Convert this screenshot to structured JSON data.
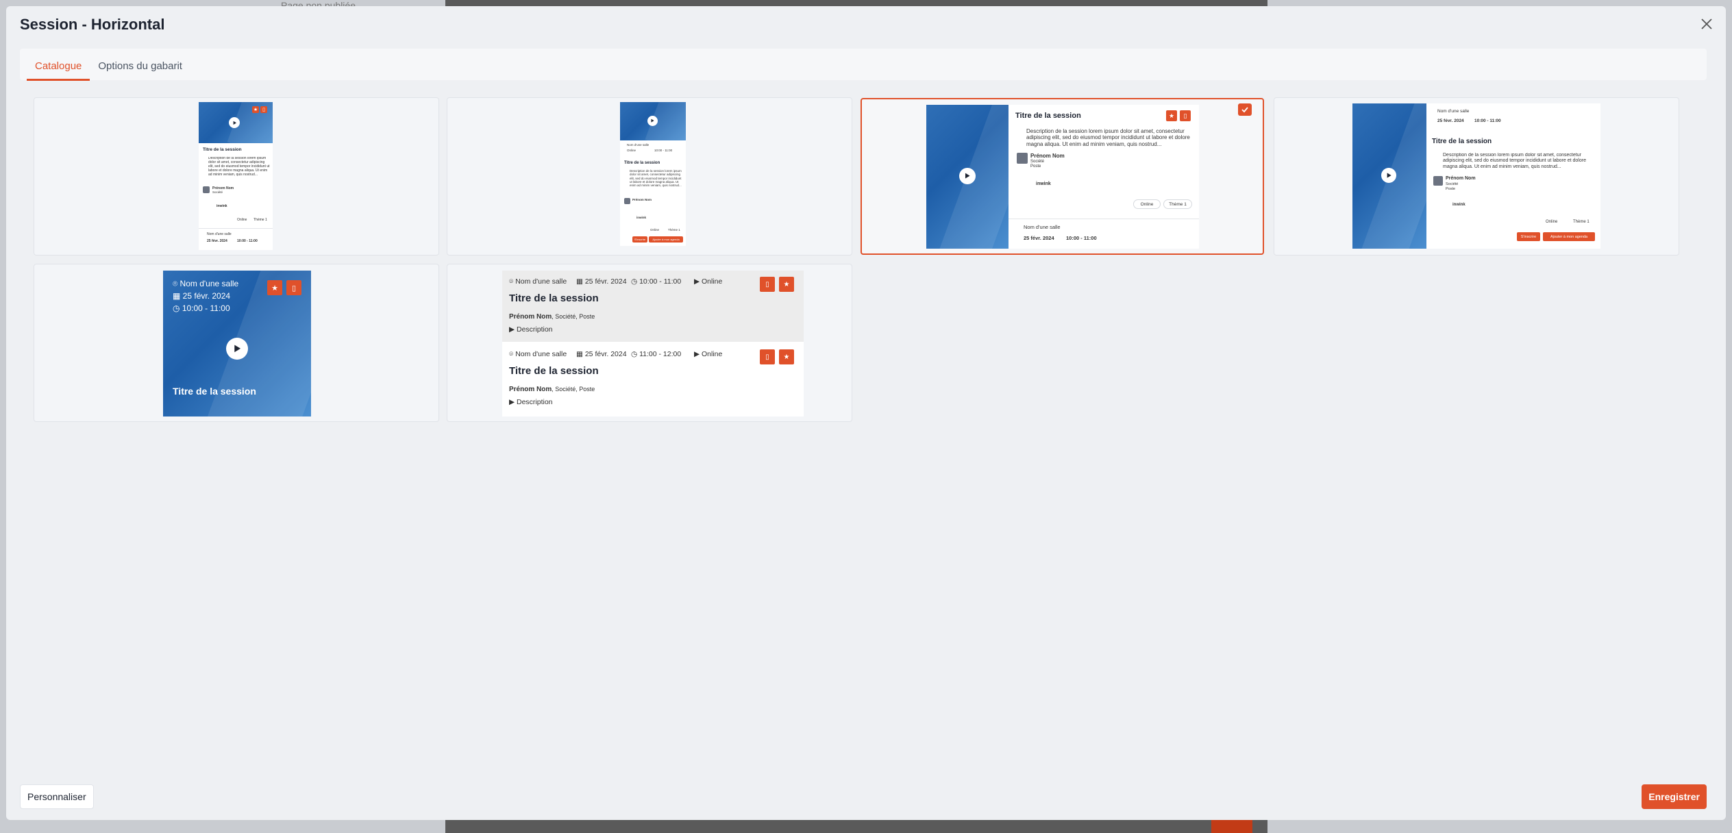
{
  "background": {
    "hint_text": "Page non publiée"
  },
  "modal": {
    "title": "Session - Horizontal",
    "tabs": [
      {
        "label": "Catalogue",
        "active": true
      },
      {
        "label": "Options du gabarit",
        "active": false
      }
    ],
    "footer": {
      "customize_label": "Personnaliser",
      "save_label": "Enregistrer"
    }
  },
  "preview": {
    "session_title": "Titre de la session",
    "description": "Description de la session lorem ipsum dolor sit amet, consectetur adipiscing elit, sed do eiusmod tempor incididunt ut labore et dolore magna aliqua. Ut enim ad minim veniam, quis nostrud...",
    "speaker_name": "Prénom Nom",
    "speaker_company": "Société",
    "speaker_role": "Poste",
    "speaker_company_role": ", Société, Poste",
    "sponsor": "inwink",
    "room": "Nom d'une salle",
    "date": "25 févr. 2024",
    "time_1": "10:00 - 11:00",
    "time_2": "11:00 - 12:00",
    "mode": "Online",
    "theme": "Thème 1",
    "description_toggle": "Description",
    "btn_primary": "S'inscrire",
    "btn_agenda": "Ajouter à mon agenda"
  },
  "colors": {
    "accent": "#e0512a",
    "hero_blue": "#2f6fb6"
  },
  "selected_template_index": 3
}
